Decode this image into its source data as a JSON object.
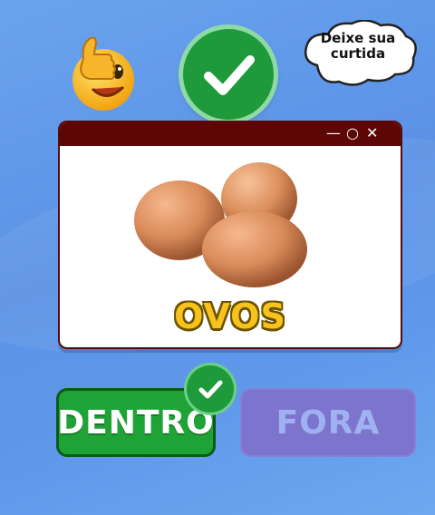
{
  "reaction": {
    "emoji_icon": "thumbs-up-wink-emoji-icon",
    "check_icon": "checkmark-icon"
  },
  "bubble": {
    "line1": "Deixe sua",
    "line2": "curtida"
  },
  "window": {
    "controls": {
      "minimize": "—",
      "maximize": "○",
      "close": "✕"
    },
    "image_icon": "eggs-image",
    "item_name": "OVOS"
  },
  "answers": {
    "inside_label": "DENTRO",
    "outside_label": "FORA",
    "selected": "inside"
  },
  "colors": {
    "correct_green": "#1e9a3a",
    "window_titlebar": "#5c0606",
    "label_yellow": "#f7c21d",
    "outside_purple": "#7f73cc"
  }
}
